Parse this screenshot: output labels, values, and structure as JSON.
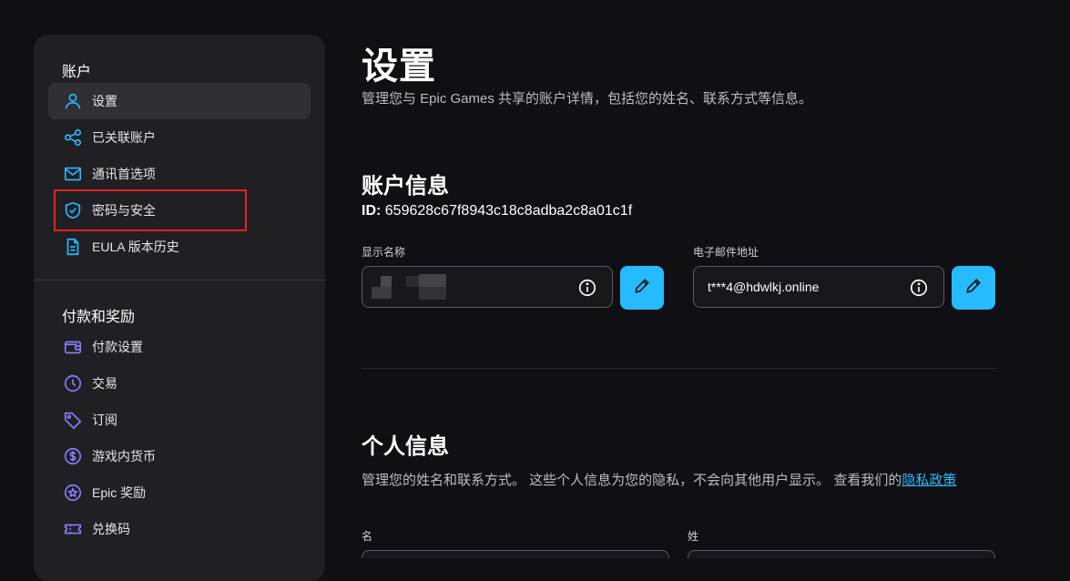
{
  "sidebar": {
    "section1_title": "账户",
    "items1": [
      {
        "label": "设置",
        "icon": "user-icon"
      },
      {
        "label": "已关联账户",
        "icon": "share-icon"
      },
      {
        "label": "通讯首选项",
        "icon": "mail-icon"
      },
      {
        "label": "密码与安全",
        "icon": "shield-icon"
      },
      {
        "label": "EULA 版本历史",
        "icon": "document-icon"
      }
    ],
    "section2_title": "付款和奖励",
    "items2": [
      {
        "label": "付款设置",
        "icon": "wallet-icon"
      },
      {
        "label": "交易",
        "icon": "clock-icon"
      },
      {
        "label": "订阅",
        "icon": "tag-icon"
      },
      {
        "label": "游戏内货币",
        "icon": "dollar-icon"
      },
      {
        "label": "Epic 奖励",
        "icon": "star-icon"
      },
      {
        "label": "兑换码",
        "icon": "ticket-icon"
      }
    ]
  },
  "main": {
    "title": "设置",
    "subtitle": "管理您与 Epic Games 共享的账户详情，包括您的姓名、联系方式等信息。",
    "account_info": {
      "heading": "账户信息",
      "id_label": "ID:",
      "id_value": "659628c67f8943c18c8adba2c8a01c1f",
      "display_name_label": "显示名称",
      "display_name_value": "",
      "email_label": "电子邮件地址",
      "email_value": "t***4@hdwlkj.online"
    },
    "personal_info": {
      "heading": "个人信息",
      "desc": "管理您的姓名和联系方式。 这些个人信息为您的隐私，不会向其他用户显示。 查看我们的",
      "privacy_link": "隐私政策",
      "first_name_label": "名",
      "last_name_label": "姓"
    }
  },
  "colors": {
    "accent": "#26bbff",
    "sidebar_icon": "#26bbff",
    "payment_icon": "#8a7cff",
    "highlight": "#e02424"
  }
}
